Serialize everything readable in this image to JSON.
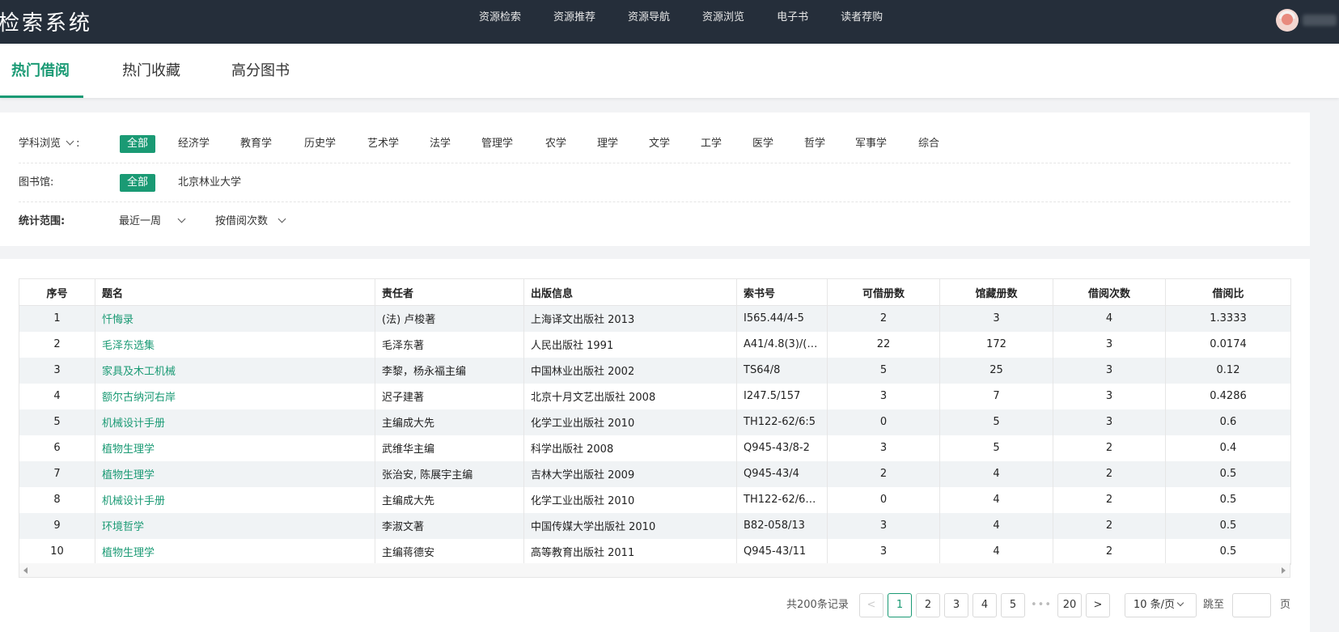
{
  "header": {
    "brand": "检索系统",
    "nav": [
      "资源检索",
      "资源推荐",
      "资源导航",
      "资源浏览",
      "电子书",
      "读者荐购"
    ]
  },
  "tabs": [
    "热门借阅",
    "热门收藏",
    "高分图书"
  ],
  "filters": {
    "subject_label": "学科浏览",
    "subject_suffix": ":",
    "subjects": [
      "全部",
      "经济学",
      "教育学",
      "历史学",
      "艺术学",
      "法学",
      "管理学",
      "农学",
      "理学",
      "文学",
      "工学",
      "医学",
      "哲学",
      "军事学",
      "综合"
    ],
    "library_label": "图书馆:",
    "libraries": [
      "全部",
      "北京林业大学"
    ],
    "range_label": "统计范围:",
    "period": "最近一周",
    "sort": "按借阅次数"
  },
  "table": {
    "columns": [
      "序号",
      "题名",
      "责任者",
      "出版信息",
      "索书号",
      "可借册数",
      "馆藏册数",
      "借阅次数",
      "借阅比"
    ],
    "rows": [
      [
        "1",
        "忏悔录",
        "(法) 卢梭著",
        "上海译文出版社 2013",
        "I565.44/4-5",
        "2",
        "3",
        "4",
        "1.3333"
      ],
      [
        "2",
        "毛泽东选集",
        "毛泽东著",
        "人民出版社 1991",
        "A41/4.8(3)/(…",
        "22",
        "172",
        "3",
        "0.0174"
      ],
      [
        "3",
        "家具及木工机械",
        "李黎，杨永福主编",
        "中国林业出版社 2002",
        "TS64/8",
        "5",
        "25",
        "3",
        "0.12"
      ],
      [
        "4",
        "额尔古纳河右岸",
        "迟子建著",
        "北京十月文艺出版社 2008",
        "I247.5/157",
        "3",
        "7",
        "3",
        "0.4286"
      ],
      [
        "5",
        "机械设计手册",
        "主编成大先",
        "化学工业出版社 2010",
        "TH122-62/6:5",
        "0",
        "5",
        "3",
        "0.6"
      ],
      [
        "6",
        "植物生理学",
        "武维华主编",
        "科学出版社 2008",
        "Q945-43/8-2",
        "3",
        "5",
        "2",
        "0.4"
      ],
      [
        "7",
        "植物生理学",
        "张治安, 陈展宇主编",
        "吉林大学出版社 2009",
        "Q945-43/4",
        "2",
        "4",
        "2",
        "0.5"
      ],
      [
        "8",
        "机械设计手册",
        "主编成大先",
        "化学工业出版社 2010",
        "TH122-62/6…",
        "0",
        "4",
        "2",
        "0.5"
      ],
      [
        "9",
        "环境哲学",
        "李淑文著",
        "中国传媒大学出版社 2010",
        "B82-058/13",
        "3",
        "4",
        "2",
        "0.5"
      ],
      [
        "10",
        "植物生理学",
        "主编蒋德安",
        "高等教育出版社 2011",
        "Q945-43/11",
        "3",
        "4",
        "2",
        "0.5"
      ]
    ]
  },
  "pagination": {
    "total": "共200条记录",
    "prev": "<",
    "pages": [
      "1",
      "2",
      "3",
      "4",
      "5"
    ],
    "ellipsis": "•••",
    "last": "20",
    "next": ">",
    "page_size": "10 条/页",
    "jump_label": "跳至",
    "jump_unit": "页"
  },
  "colors": {
    "accent": "#1a9a74",
    "header_bg": "#252e3a"
  }
}
